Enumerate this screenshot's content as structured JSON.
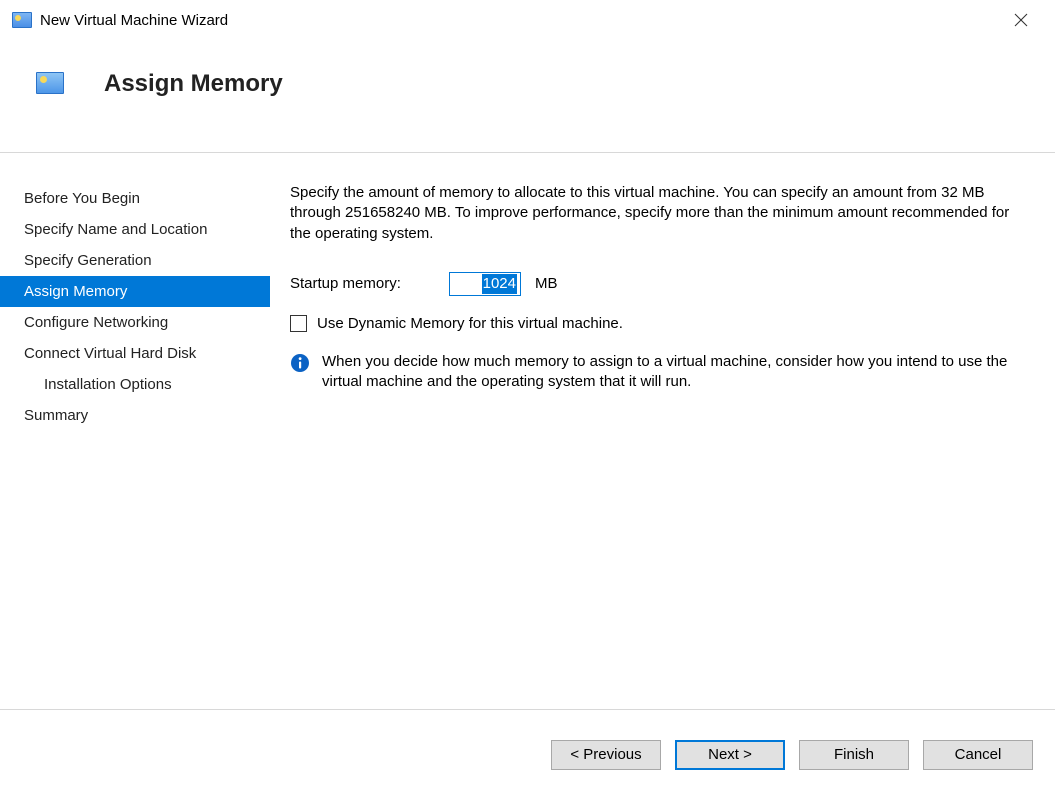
{
  "window": {
    "title": "New Virtual Machine Wizard"
  },
  "header": {
    "page_title": "Assign Memory"
  },
  "sidebar": {
    "items": [
      {
        "label": "Before You Begin",
        "indent": false,
        "active": false
      },
      {
        "label": "Specify Name and Location",
        "indent": false,
        "active": false
      },
      {
        "label": "Specify Generation",
        "indent": false,
        "active": false
      },
      {
        "label": "Assign Memory",
        "indent": false,
        "active": true
      },
      {
        "label": "Configure Networking",
        "indent": false,
        "active": false
      },
      {
        "label": "Connect Virtual Hard Disk",
        "indent": false,
        "active": false
      },
      {
        "label": "Installation Options",
        "indent": true,
        "active": false
      },
      {
        "label": "Summary",
        "indent": false,
        "active": false
      }
    ]
  },
  "content": {
    "intro": "Specify the amount of memory to allocate to this virtual machine. You can specify an amount from 32 MB through 251658240 MB. To improve performance, specify more than the minimum amount recommended for the operating system.",
    "startup_label": "Startup memory:",
    "startup_value": "1024",
    "startup_unit": "MB",
    "dynamic_label": "Use Dynamic Memory for this virtual machine.",
    "info_text": "When you decide how much memory to assign to a virtual machine, consider how you intend to use the virtual machine and the operating system that it will run."
  },
  "footer": {
    "previous": "< Previous",
    "next": "Next >",
    "finish": "Finish",
    "cancel": "Cancel"
  }
}
